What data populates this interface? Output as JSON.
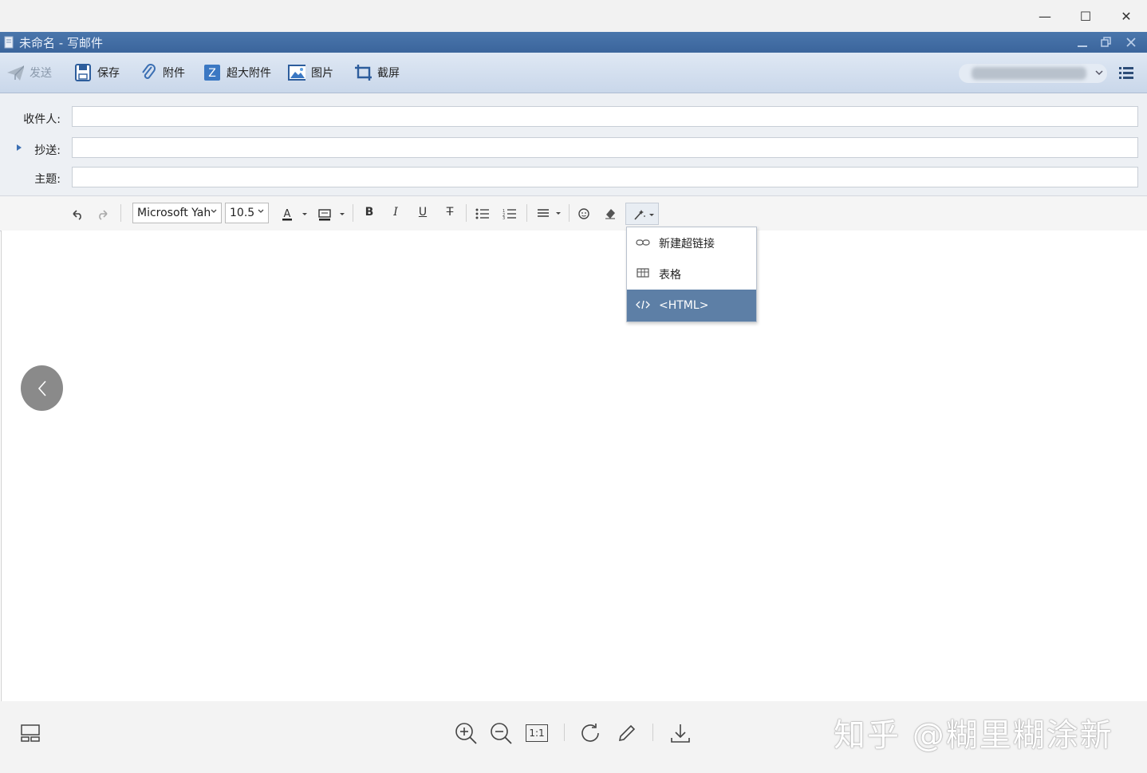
{
  "window": {
    "minimize": "—",
    "maximize": "☐",
    "close": "✕"
  },
  "app": {
    "title": "未命名 - 写邮件"
  },
  "toolbar": {
    "send": "发送",
    "save": "保存",
    "attach": "附件",
    "big_attach": "超大附件",
    "image": "图片",
    "screenshot": "截屏"
  },
  "fields": {
    "to_label": "收件人:",
    "cc_label": "抄送:",
    "subject_label": "主题:",
    "to_value": "",
    "cc_value": "",
    "subject_value": ""
  },
  "format": {
    "font_family": "Microsoft Yah",
    "font_size": "10.5"
  },
  "menu": {
    "items": [
      {
        "label": "新建超链接",
        "icon": "link-icon"
      },
      {
        "label": "表格",
        "icon": "table-icon"
      },
      {
        "label": "<HTML>",
        "icon": "code-icon"
      }
    ],
    "selected_index": 2
  },
  "viewer": {
    "actual_size": "1:1"
  },
  "watermark": "知乎 @糊里糊涂新",
  "colors": {
    "accent": "#3b659c",
    "menu_highlight": "#5d7fa6"
  }
}
